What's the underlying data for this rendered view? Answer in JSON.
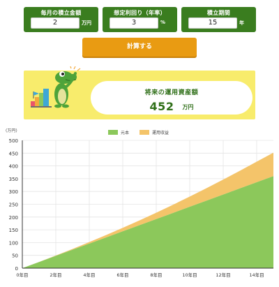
{
  "inputs": [
    {
      "label": "毎月の積立金額",
      "value": "2",
      "unit": "万円"
    },
    {
      "label": "想定利回り（年率）",
      "value": "3",
      "unit": "%"
    },
    {
      "label": "積立期間",
      "value": "15",
      "unit": "年"
    }
  ],
  "calc_button_label": "計算する",
  "result": {
    "title": "将来の運用資産額",
    "value": "452",
    "unit": "万円"
  },
  "colors": {
    "card_green": "#3a7d1f",
    "button_orange": "#e99b12",
    "principal": "#8cc85b",
    "gain": "#f4c46a",
    "result_panel": "#f8ec6c"
  },
  "chart_data": {
    "type": "area",
    "stacked": true,
    "y_unit_label": "(万円)",
    "ylim": [
      0,
      500
    ],
    "y_ticks": [
      0,
      50,
      100,
      150,
      200,
      250,
      300,
      350,
      400,
      450,
      500
    ],
    "x": [
      0,
      1,
      2,
      3,
      4,
      5,
      6,
      7,
      8,
      9,
      10,
      11,
      12,
      13,
      14,
      15
    ],
    "x_tick_labels": [
      "0年目",
      "2年目",
      "4年目",
      "6年目",
      "8年目",
      "10年目",
      "12年目",
      "14年目"
    ],
    "x_tick_positions": [
      0,
      2,
      4,
      6,
      8,
      10,
      12,
      14
    ],
    "legend_position": "top-center",
    "grid": true,
    "series": [
      {
        "name": "元本",
        "color": "#8cc85b",
        "values": [
          0,
          24,
          48,
          72,
          96,
          120,
          144,
          168,
          192,
          216,
          240,
          264,
          288,
          312,
          336,
          360
        ]
      },
      {
        "name": "運用収益",
        "color": "#f4c46a",
        "values": [
          0,
          0.3,
          1.5,
          3.3,
          6,
          9.5,
          13.8,
          18.9,
          25,
          32,
          40,
          48.8,
          58.5,
          69,
          80.5,
          92
        ]
      }
    ]
  }
}
